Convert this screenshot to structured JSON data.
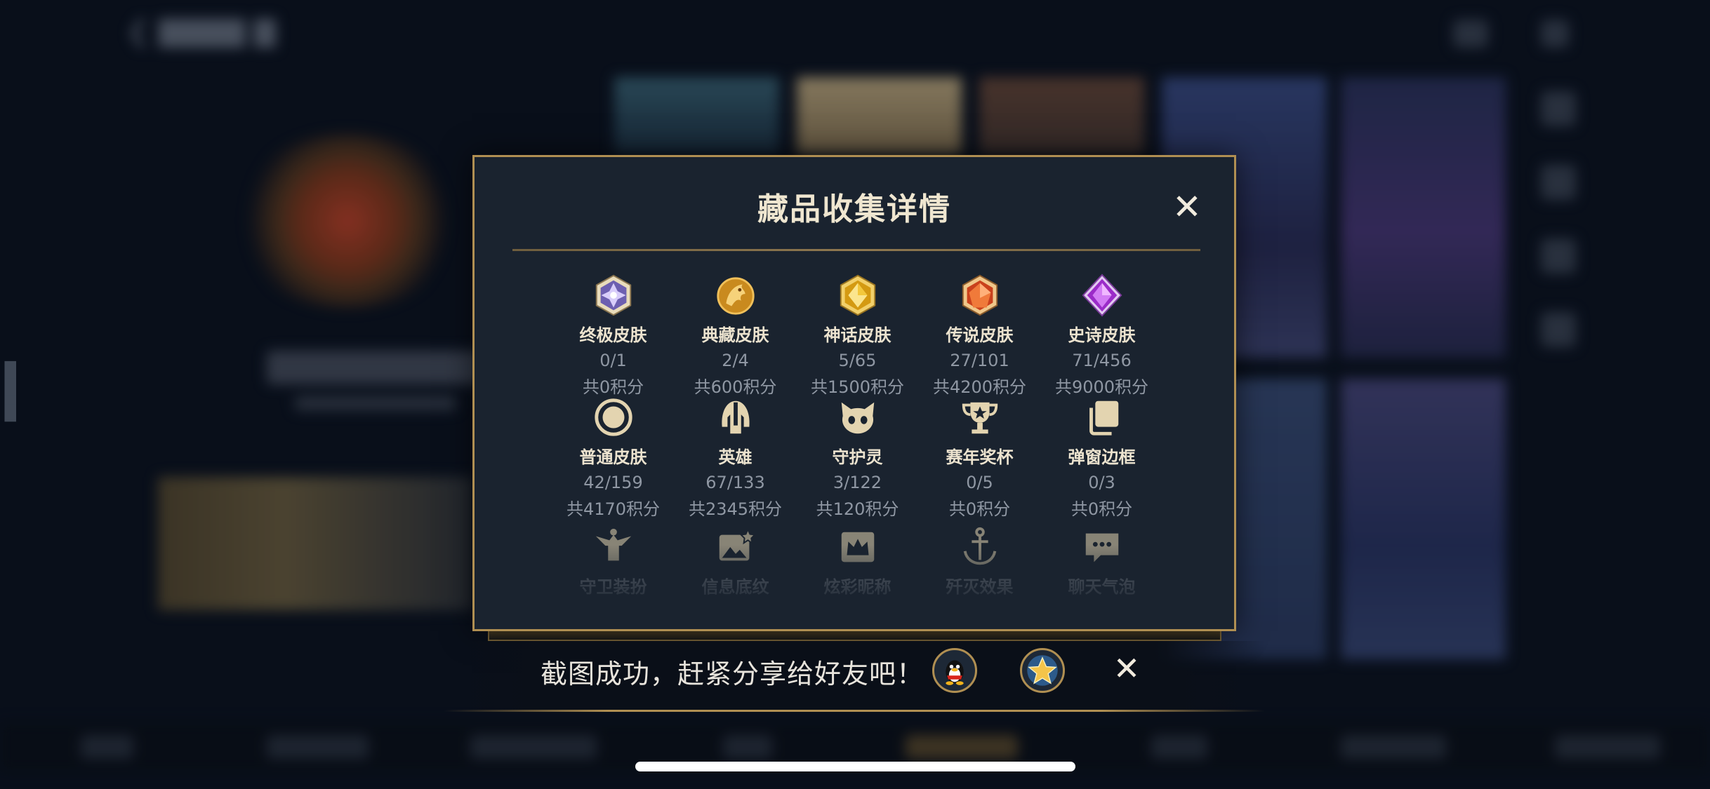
{
  "modal": {
    "title": "藏品收集详情",
    "close_symbol": "✕"
  },
  "items": [
    {
      "label": "终极皮肤",
      "count": "0/1",
      "points": "共0积分",
      "icon": "ultimate-skin-icon",
      "color": "#b9a7f0"
    },
    {
      "label": "典藏皮肤",
      "count": "2/4",
      "points": "共600积分",
      "icon": "collection-skin-icon",
      "color": "#e3a52c"
    },
    {
      "label": "神话皮肤",
      "count": "5/65",
      "points": "共1500积分",
      "icon": "mythic-skin-icon",
      "color": "#e8b320"
    },
    {
      "label": "传说皮肤",
      "count": "27/101",
      "points": "共4200积分",
      "icon": "legend-skin-icon",
      "color": "#e5632a"
    },
    {
      "label": "史诗皮肤",
      "count": "71/456",
      "points": "共9000积分",
      "icon": "epic-skin-icon",
      "color": "#b33ad8"
    },
    {
      "label": "普通皮肤",
      "count": "42/159",
      "points": "共4170积分",
      "icon": "normal-skin-icon",
      "color": "#d9c9a3"
    },
    {
      "label": "英雄",
      "count": "67/133",
      "points": "共2345积分",
      "icon": "hero-helmet-icon",
      "color": "#d9c9a3"
    },
    {
      "label": "守护灵",
      "count": "3/122",
      "points": "共120积分",
      "icon": "guardian-spirit-icon",
      "color": "#d9c9a3"
    },
    {
      "label": "赛年奖杯",
      "count": "0/5",
      "points": "共0积分",
      "icon": "trophy-icon",
      "color": "#d9c9a3"
    },
    {
      "label": "弹窗边框",
      "count": "0/3",
      "points": "共0积分",
      "icon": "popup-frame-icon",
      "color": "#d9c9a3"
    },
    {
      "label": "守卫装扮",
      "icon": "guard-costume-icon",
      "color": "#d9c9a3"
    },
    {
      "label": "信息底纹",
      "icon": "info-background-icon",
      "color": "#d9c9a3"
    },
    {
      "label": "炫彩昵称",
      "icon": "colorful-nickname-icon",
      "color": "#d9c9a3"
    },
    {
      "label": "歼灭效果",
      "icon": "annihilation-effect-icon",
      "color": "#d9c9a3"
    },
    {
      "label": "聊天气泡",
      "icon": "chat-bubble-icon",
      "color": "#d9c9a3"
    }
  ],
  "share": {
    "message": "截图成功，赶紧分享给好友吧！",
    "qq_icon": "qq-penguin-icon",
    "star_icon": "star-icon",
    "close_symbol": "✕"
  },
  "colors": {
    "accent_gold": "#b08f52",
    "modal_bg": "#1a232f",
    "text_primary": "#ece3cf",
    "text_secondary": "#8f97a3"
  }
}
